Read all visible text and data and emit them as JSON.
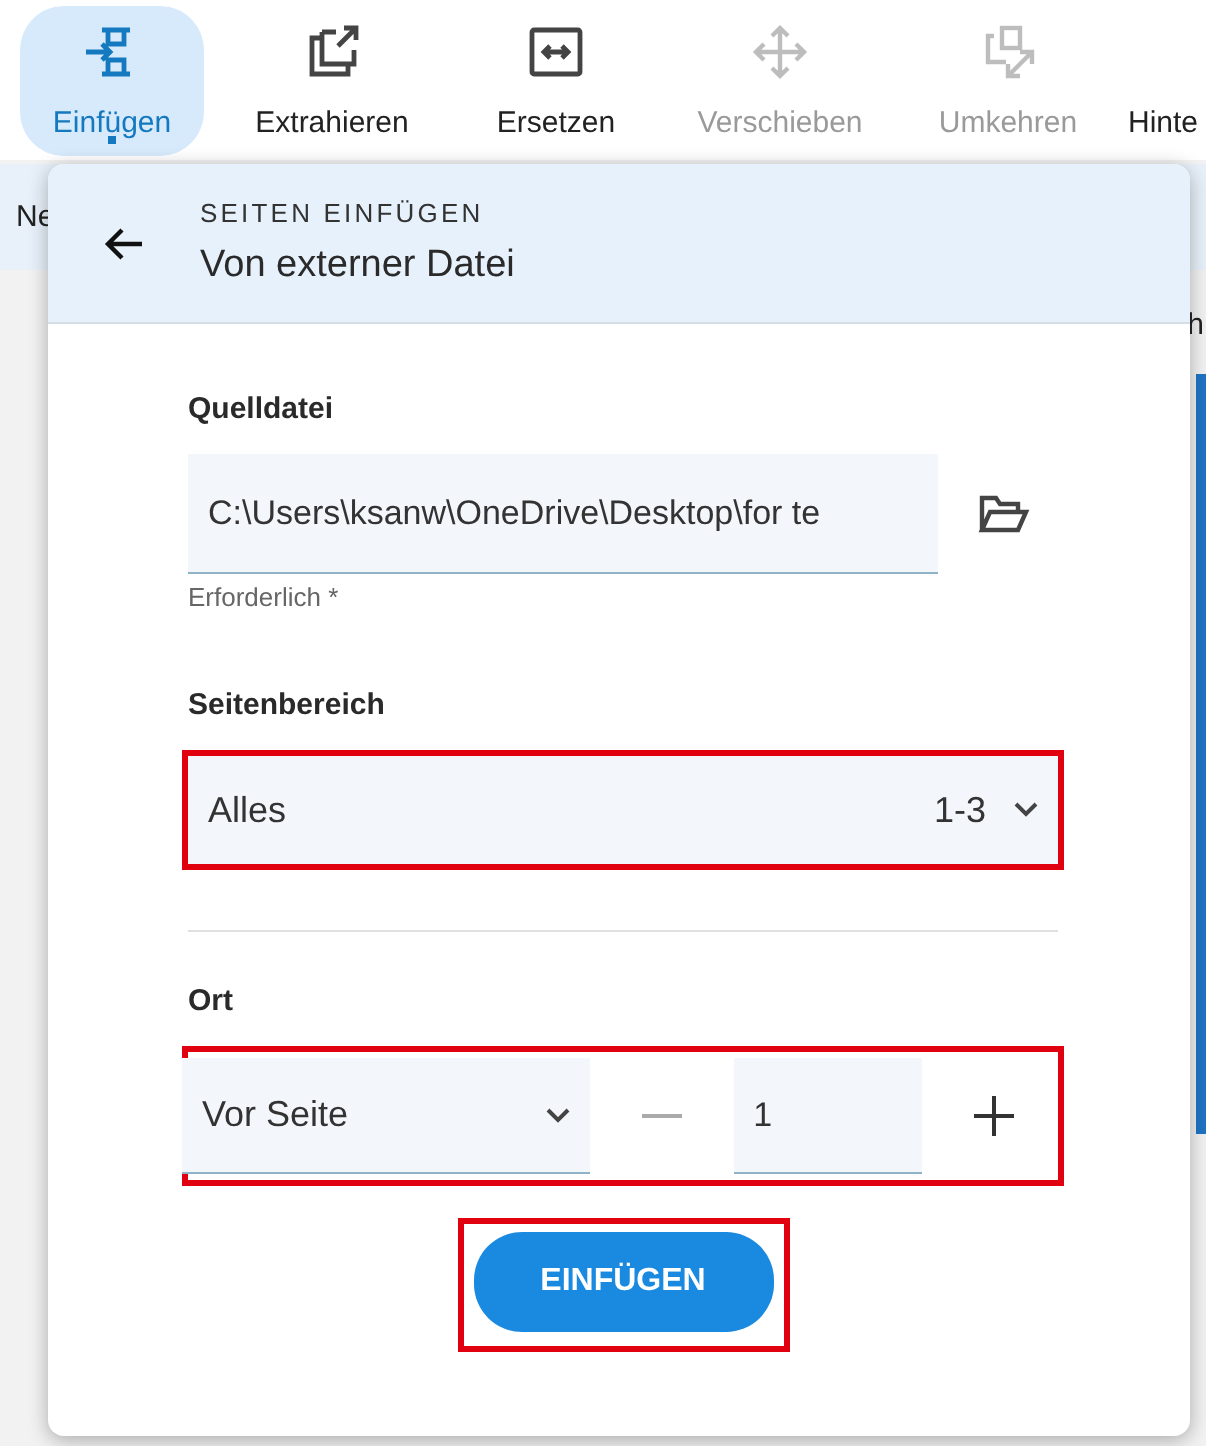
{
  "toolbar": [
    {
      "label": "Einfügen",
      "selected": true,
      "disabled": false
    },
    {
      "label": "Extrahieren",
      "selected": false,
      "disabled": false
    },
    {
      "label": "Ersetzen",
      "selected": false,
      "disabled": false
    },
    {
      "label": "Verschieben",
      "selected": false,
      "disabled": true
    },
    {
      "label": "Umkehren",
      "selected": false,
      "disabled": true
    },
    {
      "label": "Hinte",
      "selected": false,
      "disabled": false
    }
  ],
  "background": {
    "texts": [
      "Ne",
      "h"
    ]
  },
  "panel": {
    "overline": "SEITEN EINFÜGEN",
    "title": "Von externer Datei",
    "source": {
      "label": "Quelldatei",
      "value": "C:\\Users\\ksanw\\OneDrive\\Desktop\\for te",
      "hint": "Erforderlich *"
    },
    "range": {
      "label": "Seitenbereich",
      "value": "Alles",
      "pages": "1-3",
      "highlighted": true
    },
    "location": {
      "label": "Ort",
      "position": "Vor Seite",
      "page": "1",
      "highlighted": true
    },
    "submit": {
      "label": "EINFÜGEN",
      "highlighted": true
    }
  }
}
